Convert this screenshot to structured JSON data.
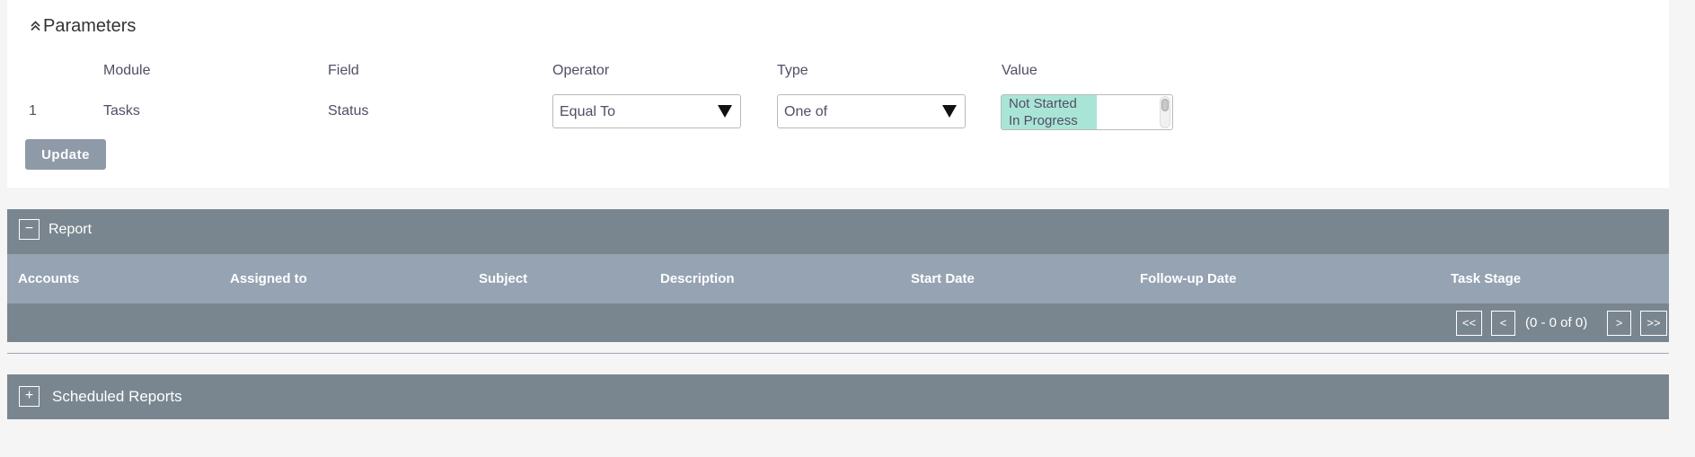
{
  "parameters": {
    "title": "Parameters",
    "columns": {
      "module": "Module",
      "field": "Field",
      "operator": "Operator",
      "type": "Type",
      "value": "Value"
    },
    "row": {
      "index": "1",
      "module": "Tasks",
      "field": "Status",
      "operator": "Equal To",
      "type": "One of",
      "values": [
        "Not Started",
        "In Progress"
      ]
    },
    "update_label": "Update"
  },
  "report": {
    "toggle": "−",
    "title": "Report",
    "columns": [
      "Accounts",
      "Assigned to",
      "Subject",
      "Description",
      "Start Date",
      "Follow-up Date",
      "Task Stage"
    ],
    "pager": {
      "first": "<<",
      "prev": "<",
      "status": "(0 - 0 of 0)",
      "next": ">",
      "last": ">>"
    }
  },
  "scheduled": {
    "toggle": "+",
    "title": "Scheduled Reports"
  },
  "icons": {
    "collapse": "chevron-double-up-icon",
    "dropdown": "caret-down-icon"
  },
  "colors": {
    "panel_header": "#7a868f",
    "table_header": "#95a3b2",
    "selected_option": "#a9e5d6",
    "button": "#8f9aa8"
  }
}
